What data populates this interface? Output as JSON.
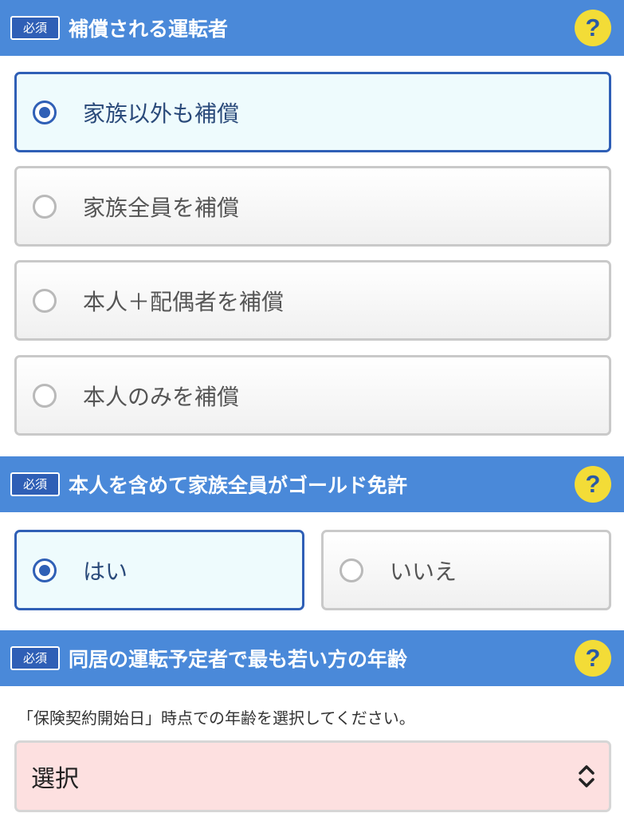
{
  "sections": [
    {
      "badge": "必須",
      "title": "補償される運転者",
      "options": [
        {
          "label": "家族以外も補償",
          "selected": true
        },
        {
          "label": "家族全員を補償",
          "selected": false
        },
        {
          "label": "本人＋配偶者を補償",
          "selected": false
        },
        {
          "label": "本人のみを補償",
          "selected": false
        }
      ]
    },
    {
      "badge": "必須",
      "title": "本人を含めて家族全員がゴールド免許",
      "options": [
        {
          "label": "はい",
          "selected": true
        },
        {
          "label": "いいえ",
          "selected": false
        }
      ]
    },
    {
      "badge": "必須",
      "title": "同居の運転予定者で最も若い方の年齢",
      "note": "「保険契約開始日」時点での年齢を選択してください。",
      "select": {
        "value": "選択"
      }
    }
  ],
  "help_icon_glyph": "?",
  "colors": {
    "header": "#4a89d9",
    "accent": "#2f5fb6",
    "help": "#f3dc37",
    "selected_bg": "#eefbfd",
    "select_bg": "#fde0e0"
  }
}
